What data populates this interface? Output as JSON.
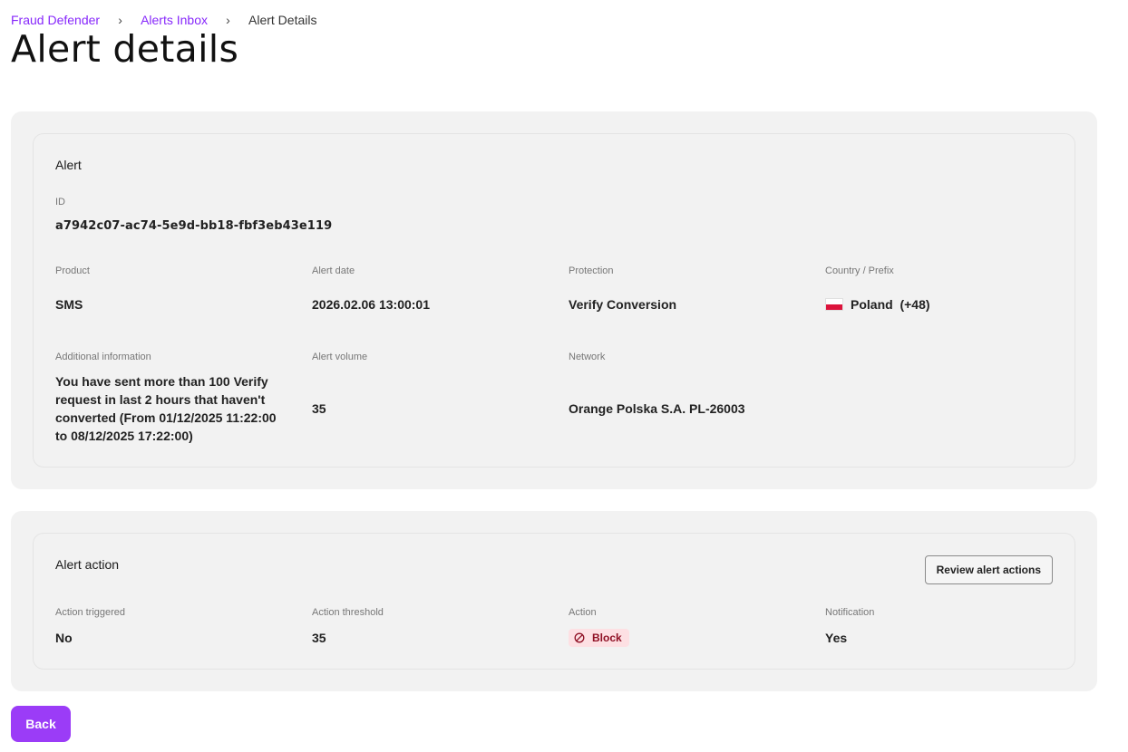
{
  "breadcrumb": {
    "items": [
      {
        "label": "Fraud Defender"
      },
      {
        "label": "Alerts Inbox"
      },
      {
        "label": "Alert Details"
      }
    ],
    "separator": "›"
  },
  "page_title": "Alert details",
  "alert": {
    "title": "Alert",
    "id_label": "ID",
    "id_value": "a7942c07-ac74-5e9d-bb18-fbf3eb43e119",
    "product_label": "Product",
    "product_value": "SMS",
    "alert_date_label": "Alert date",
    "alert_date_value": "2026.02.06 13:00:01",
    "protection_label": "Protection",
    "protection_value": "Verify Conversion",
    "country_label": "Country / Prefix",
    "country_value": "Poland",
    "country_prefix": "(+48)",
    "country_flag_icon": "poland-flag-icon",
    "additional_info_label": "Additional information",
    "additional_info_value": "You have sent more than 100 Verify request in last 2 hours that haven't converted (From 01/12/2025 11:22:00 to 08/12/2025 17:22:00)",
    "alert_volume_label": "Alert volume",
    "alert_volume_value": "35",
    "network_label": "Network",
    "network_value": "Orange Polska S.A. PL-26003"
  },
  "alert_action": {
    "title": "Alert action",
    "review_button": "Review alert actions",
    "action_triggered_label": "Action triggered",
    "action_triggered_value": "No",
    "action_threshold_label": "Action threshold",
    "action_threshold_value": "35",
    "action_label": "Action",
    "action_value": "Block",
    "action_icon": "block-icon",
    "notification_label": "Notification",
    "notification_value": "Yes"
  },
  "back_button": "Back",
  "colors": {
    "accent": "#8728fb",
    "primary_button": "#9b3cf7",
    "panel_bg": "#f2f2f2",
    "badge_bg": "#fde0e3",
    "badge_text": "#8f1024"
  }
}
